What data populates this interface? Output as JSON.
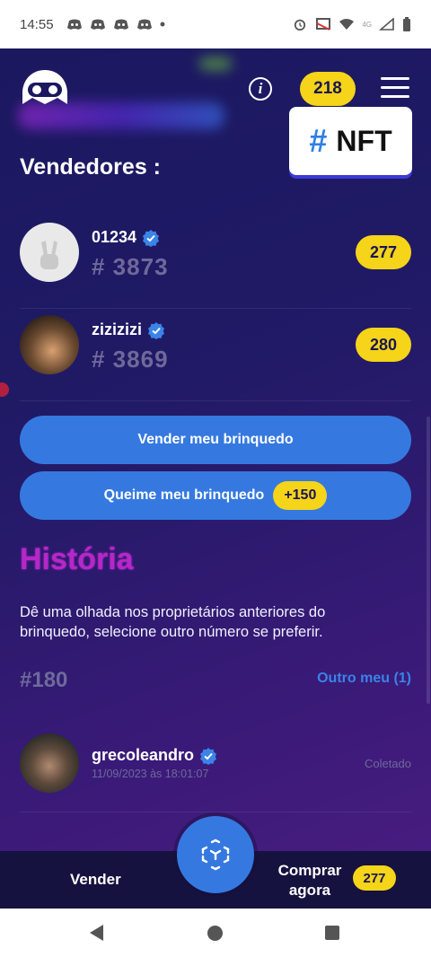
{
  "status_bar": {
    "time": "14:55",
    "network": "4G"
  },
  "header": {
    "points": "218",
    "nft_hash": "#",
    "nft_label": "NFT"
  },
  "sellers_title": "Vendedores :",
  "sellers": [
    {
      "name": "01234",
      "code": "# 3873",
      "price": "277"
    },
    {
      "name": "zizizizi",
      "code": "# 3869",
      "price": "280"
    }
  ],
  "actions": {
    "sell_label": "Vender meu brinquedo",
    "burn_label": "Queime meu brinquedo",
    "burn_bonus": "+150"
  },
  "history": {
    "title": "História",
    "description": "Dê uma olhada nos proprietários anteriores do brinquedo, selecione outro número se preferir.",
    "number": "#180",
    "other_link": "Outro meu (1)",
    "owners": [
      {
        "name": "grecoleandro",
        "date": "11/09/2023 às 18:01:07",
        "status": "Coletado"
      }
    ]
  },
  "bottom_bar": {
    "sell": "Vender",
    "buy": "Comprar agora",
    "buy_price": "277"
  },
  "colors": {
    "accent_blue": "#3579e0",
    "badge_yellow": "#f5d419",
    "history_purple": "#b627c9"
  }
}
